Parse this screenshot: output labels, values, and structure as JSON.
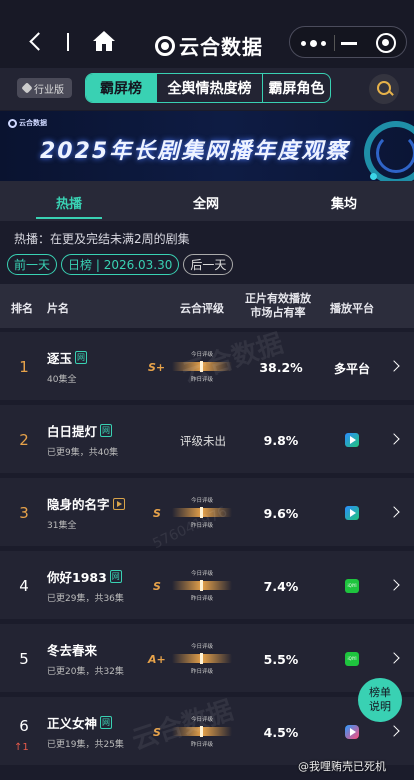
{
  "nav": {
    "app_title": "云合数据"
  },
  "category": {
    "industry_badge": "行业版",
    "tabs": [
      "霸屏榜",
      "全舆情热度榜",
      "霸屏角色"
    ]
  },
  "banner": {
    "brand": "云合数据",
    "title": "2025年长剧集网播年度观察"
  },
  "subtabs": [
    "热播",
    "全网",
    "集均"
  ],
  "note": "热播：在更及完结未满2周的剧集",
  "date": {
    "prev": "前一天",
    "current": "日榜 | 2026.03.30",
    "next": "后一天"
  },
  "table": {
    "headers": {
      "rank": "排名",
      "title": "片名",
      "grade": "云合评级",
      "share_line1": "正片有效播放",
      "share_line2": "市场占有率",
      "platform": "播放平台"
    },
    "meter_labels": {
      "today": "今日评级",
      "yesterday": "昨日评级"
    },
    "rows": [
      {
        "rank": "1",
        "title": "逐玉",
        "tag": "网",
        "episodes": "40集全",
        "grade": "S+",
        "share": "38.2%",
        "platform": "多平台",
        "platform_icon": ""
      },
      {
        "rank": "2",
        "title": "白日提灯",
        "tag": "网",
        "episodes": "已更9集，共40集",
        "grade": "",
        "grade_none": "评级未出",
        "share": "9.8%",
        "platform": "",
        "platform_icon": "tencent-video-icon"
      },
      {
        "rank": "3",
        "title": "隐身的名字",
        "tag": "play",
        "episodes": "31集全",
        "grade": "S",
        "share": "9.6%",
        "platform": "",
        "platform_icon": "tencent-video-icon"
      },
      {
        "rank": "4",
        "title": "你好1983",
        "tag": "网",
        "episodes": "已更29集，共36集",
        "grade": "S",
        "share": "7.4%",
        "platform": "",
        "platform_icon": "iqiyi-icon"
      },
      {
        "rank": "5",
        "title": "冬去春来",
        "tag": "",
        "episodes": "已更20集，共32集",
        "grade": "A+",
        "share": "5.5%",
        "platform": "",
        "platform_icon": "iqiyi-icon"
      },
      {
        "rank": "6",
        "rank_change": "↑1",
        "title": "正义女神",
        "tag": "网",
        "episodes": "已更19集，共25集",
        "grade": "S",
        "share": "4.5%",
        "platform": "",
        "platform_icon": "youku-icon"
      }
    ]
  },
  "fab": {
    "line1": "榜单",
    "line2": "说明"
  },
  "watermark": {
    "user": "@我哩贿壳已死机",
    "logo": "云合数据",
    "number": "576041976"
  },
  "colors": {
    "accent": "#39d1b3",
    "gold": "#e6a24a",
    "background": "#1b1c2b"
  }
}
